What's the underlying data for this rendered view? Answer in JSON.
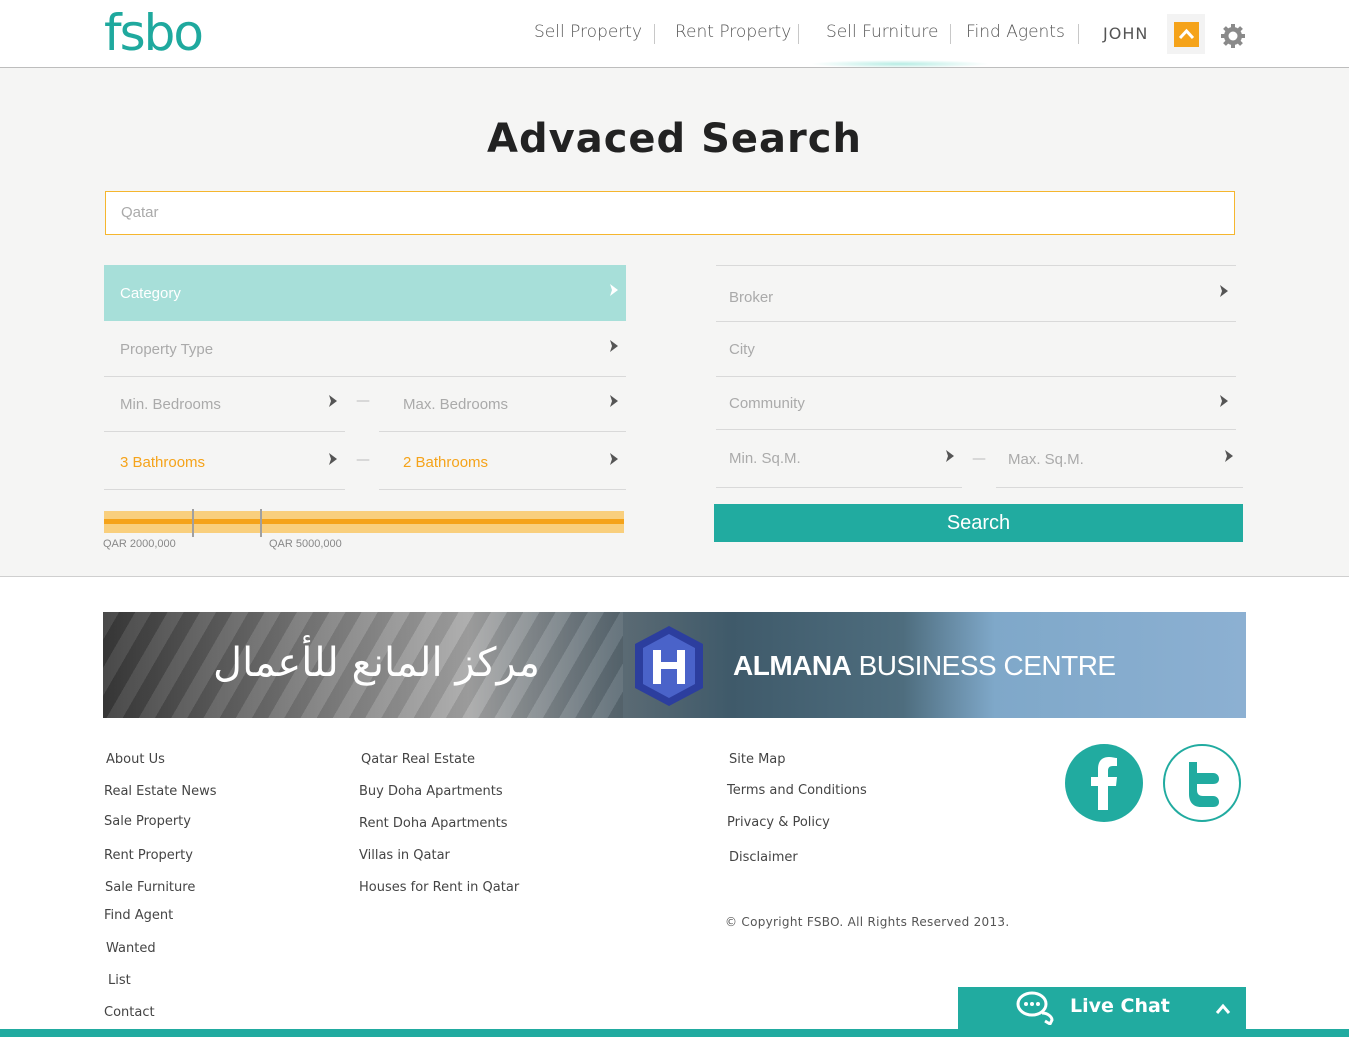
{
  "header": {
    "logo": "fsbo",
    "nav": [
      {
        "label": "Sell Property"
      },
      {
        "label": "Rent Property"
      },
      {
        "label": "Sell Furniture"
      },
      {
        "label": "Find Agents"
      }
    ],
    "user_name": "JOHN",
    "icons": {
      "user_badge": "home-up-icon",
      "settings": "gear-icon"
    }
  },
  "search": {
    "title": "Advaced Search",
    "location_value": "Qatar",
    "left_fields": {
      "category": "Category",
      "property_type": "Property Type",
      "min_bedrooms": "Min. Bedrooms",
      "max_bedrooms": "Max. Bedrooms",
      "min_bathrooms": "3 Bathrooms",
      "max_bathrooms": "2 Bathrooms"
    },
    "right_fields": {
      "broker": "Broker",
      "city": "City",
      "community": "Community",
      "min_sqm": "Min. Sq.M.",
      "max_sqm": "Max. Sq.M."
    },
    "range_dash": "—",
    "price": {
      "min_label": "QAR 2000,000",
      "max_label": "QAR 5000,000",
      "min_fraction": 0.17,
      "max_fraction": 0.3
    },
    "button": "Search"
  },
  "banner": {
    "arabic_text": "مركز المانع للأعمال",
    "english_bold": "ALMANA",
    "english_light": " BUSINESS CENTRE"
  },
  "footer": {
    "col1": [
      "About Us",
      "Real Estate News",
      "Sale Property",
      "Rent Property",
      "Sale Furniture",
      "Find Agent",
      "Wanted",
      "List",
      "Contact"
    ],
    "col2": [
      "Qatar Real Estate",
      "Buy Doha Apartments",
      "Rent Doha Apartments",
      "Villas in Qatar",
      "Houses for Rent in Qatar"
    ],
    "col3": [
      "Site Map",
      "Terms and Conditions",
      "Privacy & Policy",
      "Disclaimer"
    ],
    "copyright": "© Copyright FSBO. All Rights Reserved 2013.",
    "social": [
      "facebook-icon",
      "twitter-icon"
    ]
  },
  "livechat": {
    "label": "Live Chat"
  },
  "colors": {
    "teal": "#21aba0",
    "teal_light": "#a7dfd9",
    "orange": "#f5a31a",
    "orange_light": "#f9cf7d"
  }
}
